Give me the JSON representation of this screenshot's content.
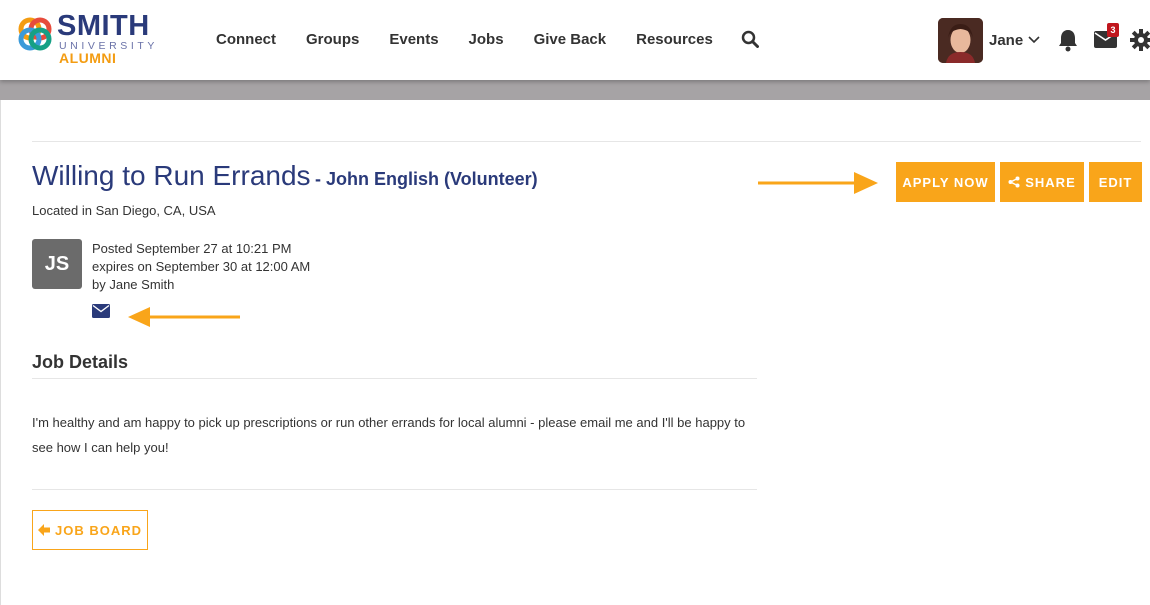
{
  "brand": {
    "name": "SMITH",
    "subtitle": "UNIVERSITY",
    "tagline": "ALUMNI",
    "colors": {
      "navy": "#2a3a7a",
      "orange": "#f9a51a",
      "badge": "#c0161d"
    }
  },
  "nav": {
    "items": [
      {
        "label": "Connect"
      },
      {
        "label": "Groups"
      },
      {
        "label": "Events"
      },
      {
        "label": "Jobs"
      },
      {
        "label": "Give Back"
      },
      {
        "label": "Resources"
      }
    ],
    "search_icon": "search-icon"
  },
  "user": {
    "name": "Jane",
    "notifications_icon": "bell-icon",
    "messages_icon": "envelope-icon",
    "messages_count": "3",
    "settings_icon": "gear-icon"
  },
  "job": {
    "title": "Willing to Run Errands",
    "subtitle": "- John English (Volunteer)",
    "location": "Located in San Diego, CA, USA",
    "poster_initials": "JS",
    "posted": "Posted September 27 at 10:21 PM",
    "expires": "expires on September 30 at 12:00 AM",
    "by": "by Jane Smith",
    "details_heading": "Job Details",
    "description": "I'm healthy and am happy to pick up prescriptions or run other errands for local alumni - please email me and I'll be happy to see how I can help you!"
  },
  "actions": {
    "apply_label": "APPLY NOW",
    "share_label": "SHARE",
    "edit_label": "EDIT",
    "job_board_label": "JOB BOARD"
  }
}
